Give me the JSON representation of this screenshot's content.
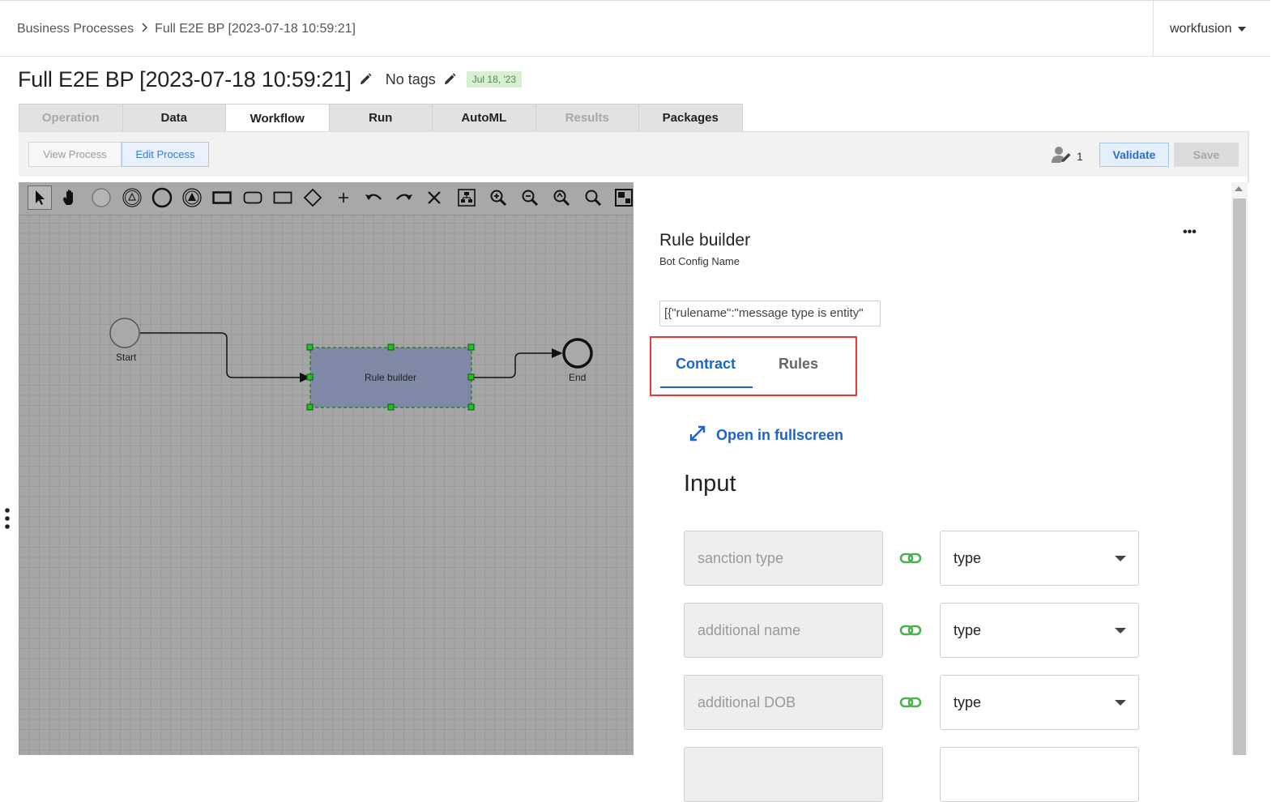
{
  "breadcrumb": {
    "root": "Business Processes",
    "current": "Full E2E BP [2023-07-18 10:59:21]"
  },
  "user_menu": {
    "label": "workfusion"
  },
  "header": {
    "title": "Full E2E BP [2023-07-18 10:59:21]",
    "tags": "No tags",
    "date_badge": "Jul 18, '23"
  },
  "tabs": [
    {
      "label": "Operation",
      "state": "disabled"
    },
    {
      "label": "Data",
      "state": "normal"
    },
    {
      "label": "Workflow",
      "state": "active"
    },
    {
      "label": "Run",
      "state": "normal"
    },
    {
      "label": "AutoML",
      "state": "normal"
    },
    {
      "label": "Results",
      "state": "disabled"
    },
    {
      "label": "Packages",
      "state": "normal"
    }
  ],
  "subbar": {
    "view_process": "View Process",
    "edit_process": "Edit Process",
    "editor_count": "1",
    "validate": "Validate",
    "save": "Save"
  },
  "palette": [
    "pointer-tool",
    "hand-tool",
    "start-event",
    "intermediate-event",
    "end-event",
    "terminate-event",
    "task",
    "subprocess",
    "transaction",
    "gateway",
    "add",
    "undo",
    "redo",
    "delete",
    "auto-layout",
    "zoom-in",
    "zoom-out",
    "zoom-fit",
    "zoom-actual",
    "overview"
  ],
  "diagram": {
    "start_label": "Start",
    "task_label": "Rule builder",
    "end_label": "End"
  },
  "panel": {
    "title": "Rule builder",
    "subtitle": "Bot Config Name",
    "more": "•••",
    "config_value": "[{\"rulename\":\"message type is entity\"",
    "tabs": {
      "contract": "Contract",
      "rules": "Rules"
    },
    "fullscreen": "Open in fullscreen",
    "input_heading": "Input",
    "mappings": [
      {
        "source": "sanction type",
        "target": "type"
      },
      {
        "source": "additional name",
        "target": "type"
      },
      {
        "source": "additional DOB",
        "target": "type"
      }
    ]
  },
  "colors": {
    "accent": "#1a63d1",
    "highlight_border": "#e53935",
    "link_icon": "#4caf50",
    "date_badge_bg": "#d8efd4"
  }
}
